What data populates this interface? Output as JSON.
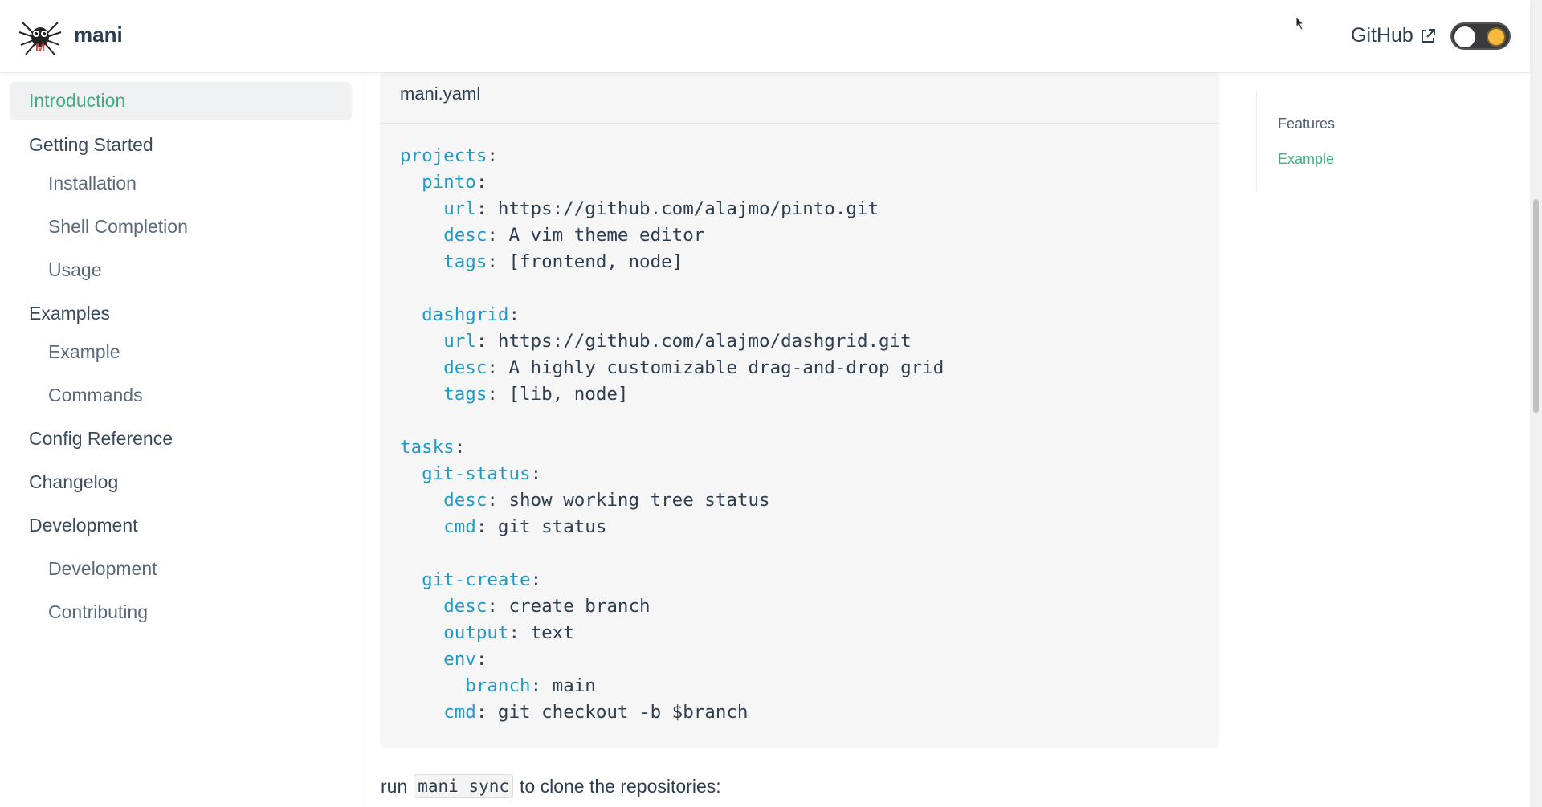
{
  "header": {
    "site_title": "mani",
    "github_label": "GitHub",
    "logo_icon": "spider-logo-icon",
    "external_icon": "external-link-icon"
  },
  "sidebar": {
    "active": "Introduction",
    "items": [
      {
        "label": "Getting Started",
        "level": 0
      },
      {
        "label": "Installation",
        "level": 1
      },
      {
        "label": "Shell Completion",
        "level": 1
      },
      {
        "label": "Usage",
        "level": 1
      },
      {
        "label": "Examples",
        "level": 0
      },
      {
        "label": "Example",
        "level": 1
      },
      {
        "label": "Commands",
        "level": 1
      },
      {
        "label": "Config Reference",
        "level": 0
      },
      {
        "label": "Changelog",
        "level": 0
      },
      {
        "label": "Development",
        "level": 0
      },
      {
        "label": "Development",
        "level": 1
      },
      {
        "label": "Contributing",
        "level": 1
      }
    ]
  },
  "code": {
    "filename": "mani.yaml",
    "lines": [
      {
        "key": "projects",
        "indent": 0,
        "value": ""
      },
      {
        "key": "pinto",
        "indent": 1,
        "value": ""
      },
      {
        "key": "url",
        "indent": 2,
        "value": "https://github.com/alajmo/pinto.git"
      },
      {
        "key": "desc",
        "indent": 2,
        "value": "A vim theme editor"
      },
      {
        "key": "tags",
        "indent": 2,
        "value": "[frontend, node]"
      },
      {
        "key": "",
        "indent": 0,
        "value": ""
      },
      {
        "key": "dashgrid",
        "indent": 1,
        "value": ""
      },
      {
        "key": "url",
        "indent": 2,
        "value": "https://github.com/alajmo/dashgrid.git"
      },
      {
        "key": "desc",
        "indent": 2,
        "value": "A highly customizable drag-and-drop grid"
      },
      {
        "key": "tags",
        "indent": 2,
        "value": "[lib, node]"
      },
      {
        "key": "",
        "indent": 0,
        "value": ""
      },
      {
        "key": "tasks",
        "indent": 0,
        "value": ""
      },
      {
        "key": "git-status",
        "indent": 1,
        "value": ""
      },
      {
        "key": "desc",
        "indent": 2,
        "value": "show working tree status"
      },
      {
        "key": "cmd",
        "indent": 2,
        "value": "git status"
      },
      {
        "key": "",
        "indent": 0,
        "value": ""
      },
      {
        "key": "git-create",
        "indent": 1,
        "value": ""
      },
      {
        "key": "desc",
        "indent": 2,
        "value": "create branch"
      },
      {
        "key": "output",
        "indent": 2,
        "value": "text"
      },
      {
        "key": "env",
        "indent": 2,
        "value": ""
      },
      {
        "key": "branch",
        "indent": 3,
        "value": "main"
      },
      {
        "key": "cmd",
        "indent": 2,
        "value": "git checkout -b $branch"
      }
    ]
  },
  "run_line": {
    "prefix": "run",
    "code": "mani sync",
    "suffix": "to clone the repositories:"
  },
  "toc": {
    "items": [
      {
        "label": "Features",
        "active": false
      },
      {
        "label": "Example",
        "active": true
      }
    ]
  },
  "colors": {
    "accent": "#3eaf7c",
    "yaml_key": "#1f9bc9"
  }
}
